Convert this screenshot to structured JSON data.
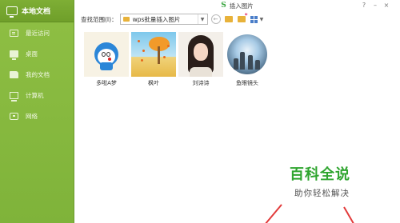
{
  "sidebar": {
    "title": "本地文档",
    "items": [
      {
        "label": "最近访问",
        "icon": "recent-icon"
      },
      {
        "label": "桌面",
        "icon": "desktop-icon"
      },
      {
        "label": "我的文档",
        "icon": "documents-icon"
      },
      {
        "label": "计算机",
        "icon": "computer-icon"
      },
      {
        "label": "网络",
        "icon": "network-icon"
      }
    ]
  },
  "dialog": {
    "title": "插入图片",
    "logo_text": "S",
    "toolbar": {
      "lookin_label": "查找范围(I)：",
      "path_value": "wps批量插入图片"
    },
    "files": [
      {
        "name": "多啦A梦"
      },
      {
        "name": "枫叶"
      },
      {
        "name": "刘诗诗"
      },
      {
        "name": "鱼眼镜头"
      }
    ]
  },
  "watermark": {
    "title": "百科全说",
    "subtitle": "助你轻松解决"
  },
  "colors": {
    "sidebar_green": "#8fbf44",
    "watermark_green": "#2fa52f",
    "arrow_red": "#e23a3a"
  }
}
